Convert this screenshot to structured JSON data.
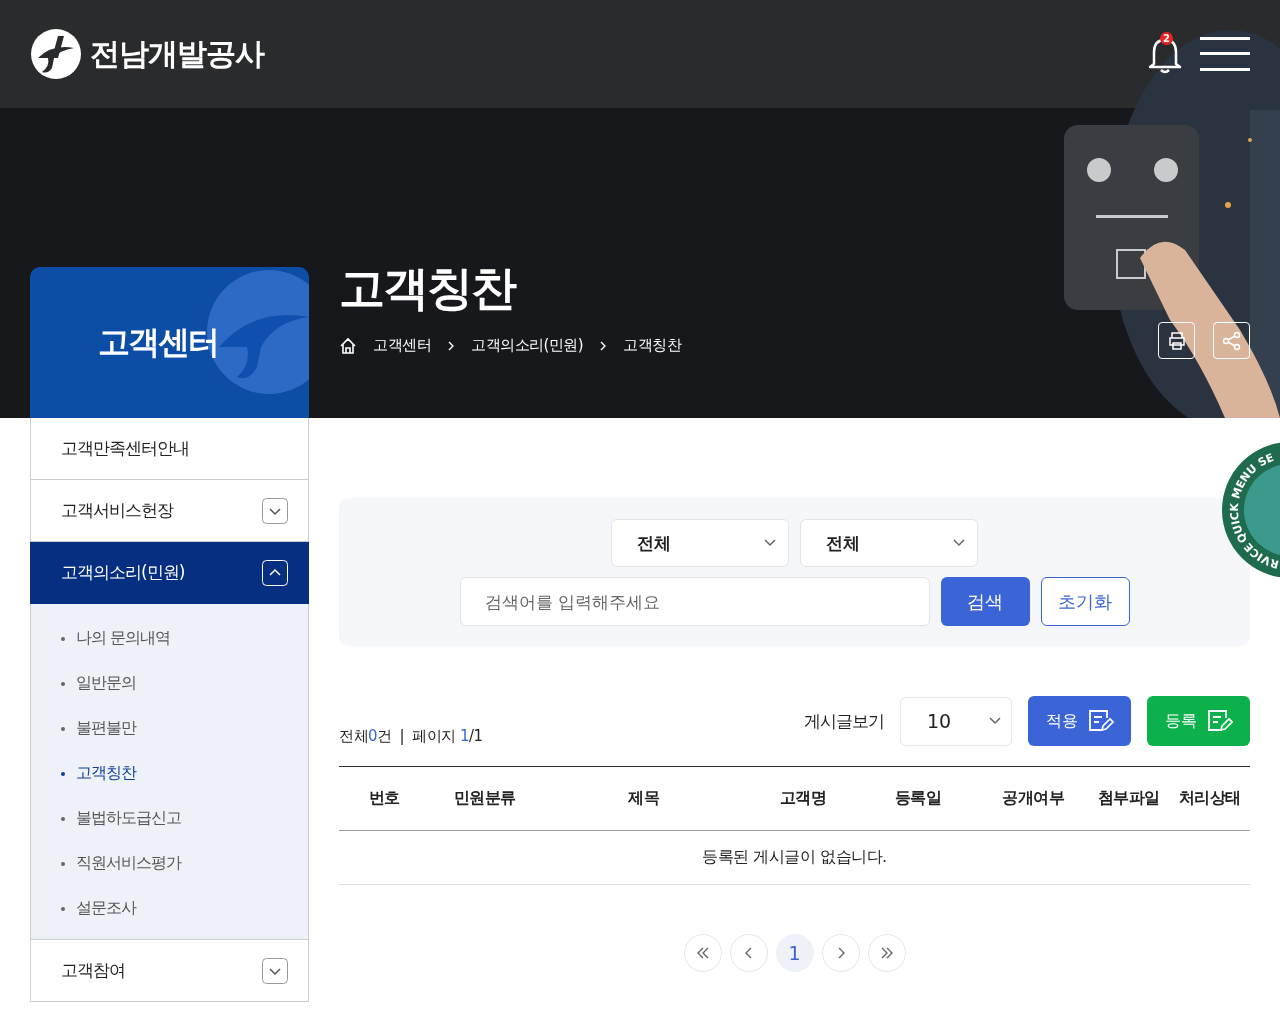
{
  "header": {
    "logo_text": "전남개발공사",
    "notification_count": "2"
  },
  "hero": {
    "title": "고객칭찬",
    "breadcrumb": [
      "고객센터",
      "고객의소리(민원)",
      "고객칭찬"
    ]
  },
  "quick_menu": {
    "label_top": "QUICK MENU SE",
    "label_bottom": "RVICE"
  },
  "sidebar": {
    "title": "고객센터",
    "items": [
      {
        "label": "고객만족센터안내",
        "expandable": false,
        "expanded": false,
        "selected": false
      },
      {
        "label": "고객서비스헌장",
        "expandable": true,
        "expanded": false,
        "selected": false
      },
      {
        "label": "고객의소리(민원)",
        "expandable": true,
        "expanded": true,
        "selected": true,
        "children": [
          {
            "label": "나의 문의내역",
            "selected": false
          },
          {
            "label": "일반문의",
            "selected": false
          },
          {
            "label": "불편불만",
            "selected": false
          },
          {
            "label": "고객칭찬",
            "selected": true
          },
          {
            "label": "불법하도급신고",
            "selected": false
          },
          {
            "label": "직원서비스평가",
            "selected": false
          },
          {
            "label": "설문조사",
            "selected": false
          }
        ]
      },
      {
        "label": "고객참여",
        "expandable": true,
        "expanded": false,
        "selected": false
      }
    ]
  },
  "search": {
    "selects": [
      "전체",
      "전체"
    ],
    "placeholder": "검색어를 입력해주세요",
    "search_button": "검색",
    "reset_button": "초기화"
  },
  "summary": {
    "total_label": "전체",
    "total_count": "0",
    "total_unit": "건",
    "separator": "|",
    "page_label": "페이지",
    "page_current": "1",
    "page_total": "/1"
  },
  "list_controls": {
    "per_page_label": "게시글보기",
    "per_page": "10",
    "apply_button": "적용",
    "write_button": "등록"
  },
  "table": {
    "columns": [
      "번호",
      "민원분류",
      "제목",
      "고객명",
      "등록일",
      "공개여부",
      "첨부파일",
      "처리상태"
    ],
    "empty_message": "등록된 게시글이 없습니다."
  },
  "pagination": [
    {
      "kind": "first"
    },
    {
      "kind": "prev"
    },
    {
      "kind": "page",
      "label": "1",
      "selected": true
    },
    {
      "kind": "next"
    },
    {
      "kind": "last"
    }
  ]
}
